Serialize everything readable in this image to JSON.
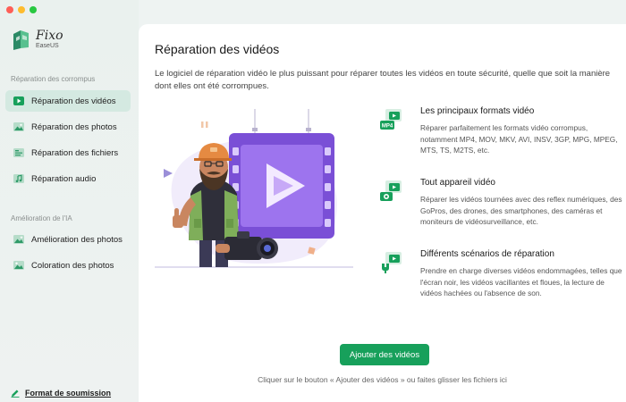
{
  "app": {
    "name": "Fixo",
    "subname": "EaseUS"
  },
  "sidebar": {
    "section_repair": "Réparation des corrompus",
    "repair_items": [
      {
        "label": "Réparation des vidéos",
        "icon": "video-play-icon",
        "active": true
      },
      {
        "label": "Réparation des photos",
        "icon": "photo-icon",
        "active": false
      },
      {
        "label": "Réparation des fichiers",
        "icon": "file-icon",
        "active": false
      },
      {
        "label": "Réparation audio",
        "icon": "music-note-icon",
        "active": false
      }
    ],
    "section_ai": "Amélioration de l'IA",
    "ai_items": [
      {
        "label": "Amélioration des photos",
        "icon": "photo-enhance-icon"
      },
      {
        "label": "Coloration des photos",
        "icon": "photo-color-icon"
      }
    ],
    "bottom_link": "Format de soumission"
  },
  "main": {
    "title": "Réparation des vidéos",
    "intro": "Le logiciel de réparation vidéo le plus puissant pour réparer toutes les vidéos en toute sécurité, quelle que soit la manière dont elles ont été corrompues.",
    "features": [
      {
        "title": "Les principaux formats vidéo",
        "badge": "MP4",
        "desc": "Réparer parfaitement les formats vidéo corrompus, notamment MP4, MOV, MKV, AVI, INSV, 3GP, MPG, MPEG, MTS, TS, M2TS, etc."
      },
      {
        "title": "Tout appareil vidéo",
        "desc": "Réparer les vidéos tournées avec des reflex numériques, des GoPros, des drones, des smartphones, des caméras et moniteurs de vidéosurveillance, etc."
      },
      {
        "title": "Différents scénarios de réparation",
        "desc": "Prendre en charge diverses vidéos endommagées, telles que l'écran noir, les vidéos vacillantes et floues, la lecture de vidéos hachées ou l'absence de son."
      }
    ],
    "add_button": "Ajouter des vidéos",
    "hint": "Cliquer sur le bouton « Ajouter des vidéos » ou faites glisser les fichiers ici"
  },
  "colors": {
    "accent": "#17a05b",
    "active_bg": "#d4e9e1",
    "video_panel": "#7a4fd6"
  }
}
